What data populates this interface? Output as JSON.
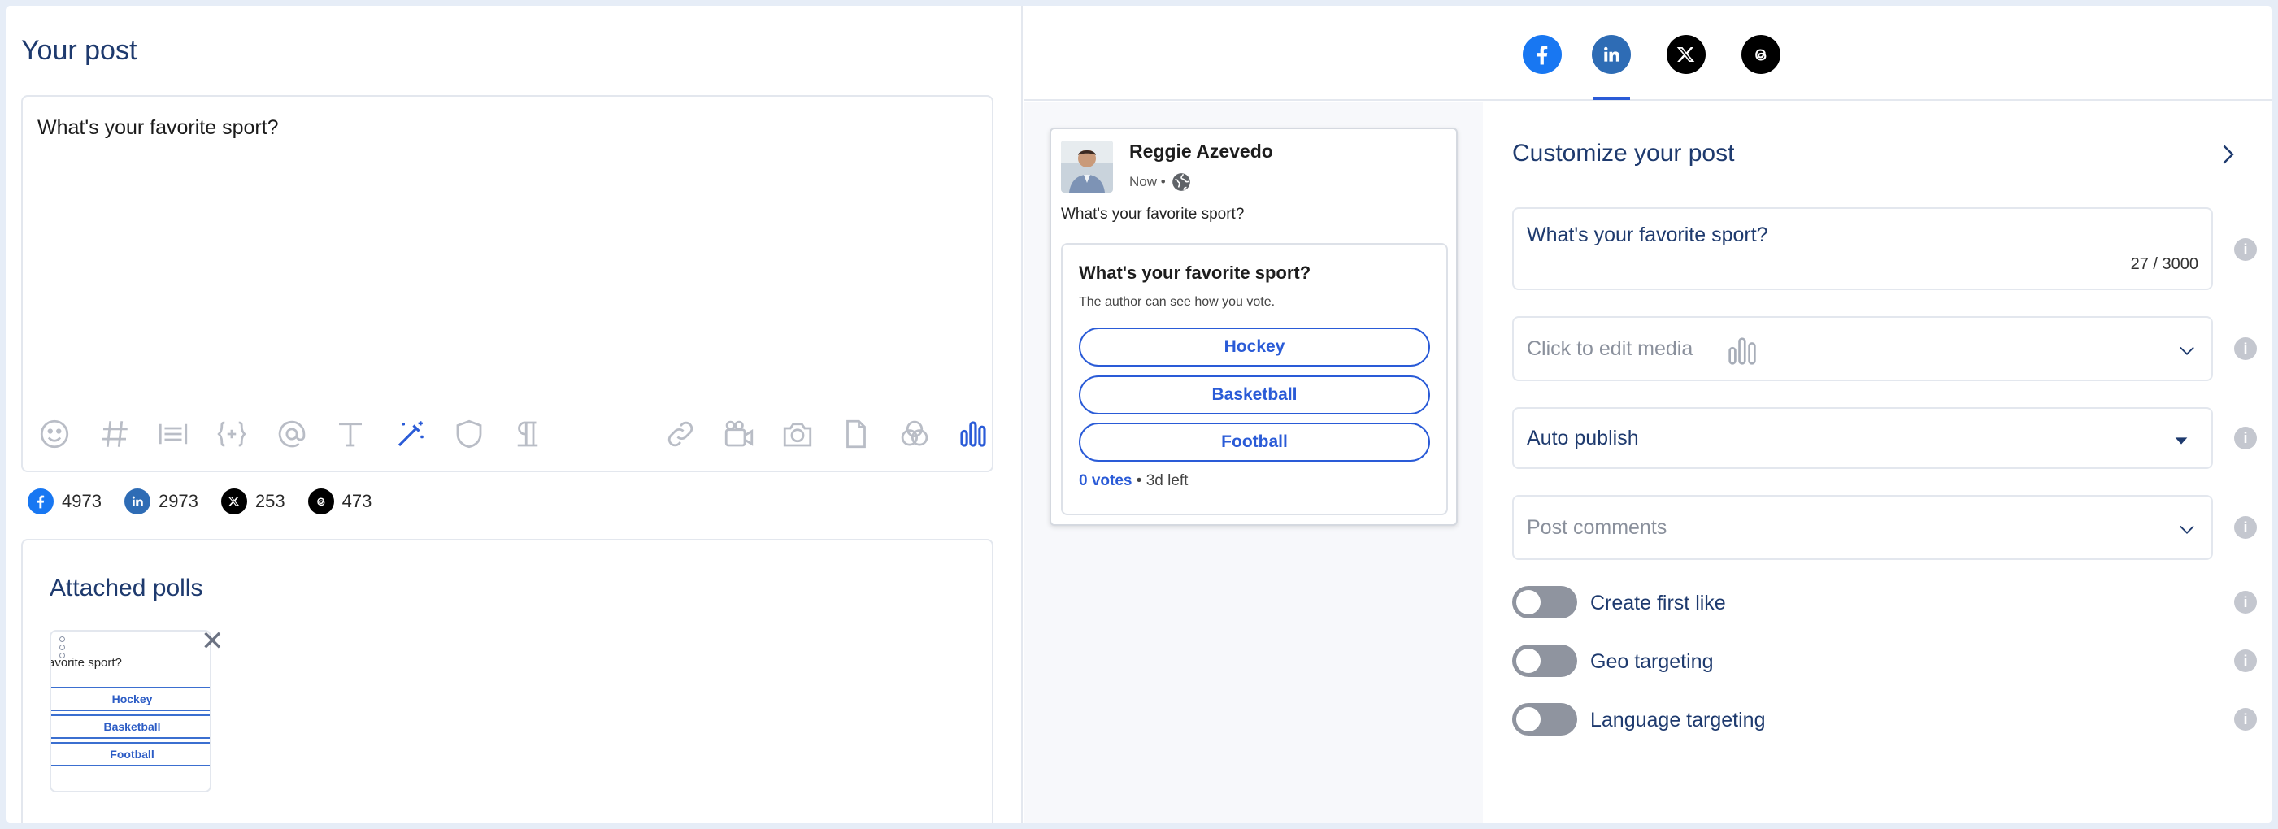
{
  "left": {
    "title": "Your post",
    "editor_text": "What's your favorite sport?",
    "counts": [
      {
        "network": "facebook",
        "value": "4973",
        "color": "#1877f2"
      },
      {
        "network": "linkedin",
        "value": "2973",
        "color": "#2e6cb5"
      },
      {
        "network": "x",
        "value": "253",
        "color": "#000000"
      },
      {
        "network": "threads",
        "value": "473",
        "color": "#000000"
      }
    ],
    "polls_title": "Attached polls",
    "thumb": {
      "question": "avorite sport?",
      "options": [
        "Hockey",
        "Basketball",
        "Football"
      ],
      "close_symbol": "✕"
    }
  },
  "preview": {
    "author": "Reggie Azevedo",
    "time": "Now •",
    "text": "What's your favorite sport?",
    "poll": {
      "question": "What's your favorite sport?",
      "subtitle": "The author can see how you vote.",
      "options": [
        "Hockey",
        "Basketball",
        "Football"
      ],
      "votes": "0 votes",
      "time_left": " • 3d left"
    }
  },
  "customize": {
    "title": "Customize your post",
    "text_value": "What's your favorite sport?",
    "char_count": "27 / 3000",
    "media_placeholder": "Click to edit media",
    "publish_value": "Auto publish",
    "comments_placeholder": "Post comments",
    "toggles": [
      "Create first like",
      "Geo targeting",
      "Language targeting"
    ],
    "info_symbol": "i"
  },
  "colors": {
    "accent": "#2a5bd7",
    "title": "#1e3a6e"
  }
}
